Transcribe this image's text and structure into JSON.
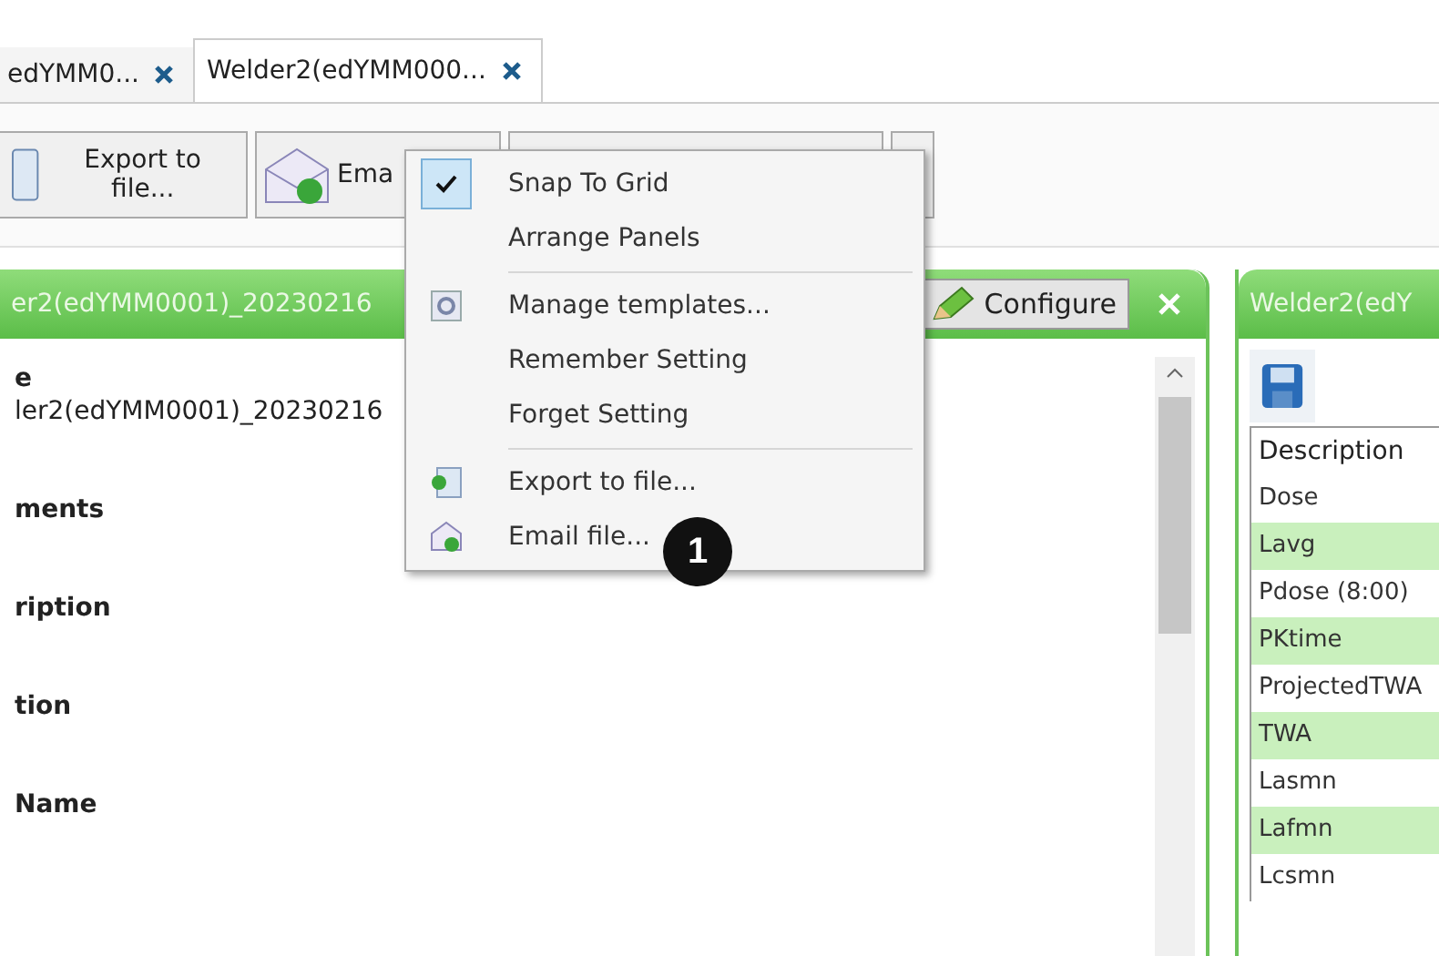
{
  "tabs": [
    {
      "label": "edYMM0...",
      "selected": false
    },
    {
      "label": "Welder2(edYMM000...",
      "selected": true
    }
  ],
  "toolbar": {
    "export_button": "Export to file...",
    "email_button": "Ema"
  },
  "left_panel": {
    "title": "er2(edYMM0001)_20230216",
    "configure_button": "Configure",
    "fields": [
      {
        "label": "e",
        "value": "ler2(edYMM0001)_20230216"
      },
      {
        "label": "ments"
      },
      {
        "label": "ription"
      },
      {
        "label": "tion"
      },
      {
        "label": "Name"
      }
    ]
  },
  "right_panel": {
    "title": "Welder2(edY",
    "column": "Description",
    "rows": [
      "Dose",
      "Lavg",
      "Pdose (8:00)",
      "PKtime",
      "ProjectedTWA",
      "TWA",
      "Lasmn",
      "Lafmn",
      "Lcsmn"
    ]
  },
  "menu": {
    "groups": [
      [
        {
          "label": "Snap To Grid",
          "kind": "toggle",
          "checked": true
        },
        {
          "label": "Arrange Panels",
          "kind": "toggle",
          "checked": false
        }
      ],
      [
        {
          "label": "Manage templates...",
          "kind": "gear"
        },
        {
          "label": "Remember Setting",
          "kind": "plain"
        },
        {
          "label": "Forget Setting",
          "kind": "plain"
        }
      ],
      [
        {
          "label": "Export to file...",
          "kind": "export"
        },
        {
          "label": "Email file...",
          "kind": "email"
        }
      ]
    ]
  },
  "callout": "1"
}
